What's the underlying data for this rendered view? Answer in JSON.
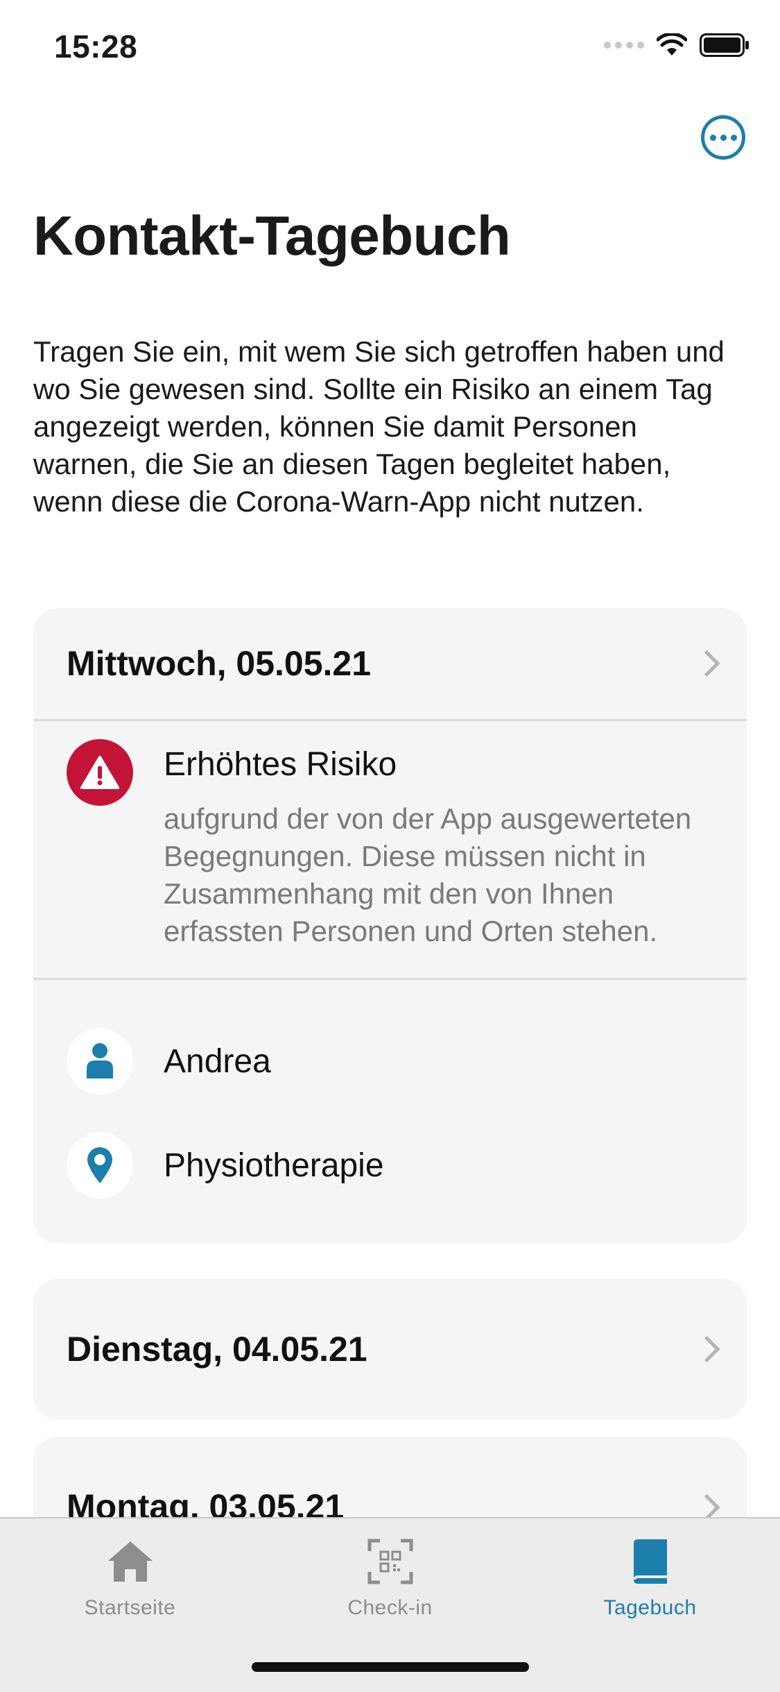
{
  "status_bar": {
    "time": "15:28"
  },
  "header": {
    "title": "Kontakt-Tagebuch",
    "intro": "Tragen Sie ein, mit wem Sie sich getroffen haben und wo Sie gewesen sind. Sollte ein Risiko an einem Tag angezeigt werden, können Sie damit Personen warnen, die Sie an diesen Tagen begleitet haben, wenn diese die Corona-Warn-App nicht nutzen."
  },
  "days": [
    {
      "title": "Mittwoch, 05.05.21",
      "risk": {
        "title": "Erhöhtes Risiko",
        "description": "aufgrund der von der App ausgewerteten Begegnungen. Diese müssen nicht in Zusammenhang mit den von Ihnen erfassten Personen und Orten stehen."
      },
      "entries": [
        {
          "icon": "person-icon",
          "label": "Andrea"
        },
        {
          "icon": "location-pin-icon",
          "label": "Physiotherapie"
        }
      ]
    },
    {
      "title": "Dienstag, 04.05.21"
    },
    {
      "title": "Montag, 03.05.21"
    }
  ],
  "tabs": [
    {
      "icon": "home-icon",
      "label": "Startseite",
      "active": false
    },
    {
      "icon": "qr-code-icon",
      "label": "Check-in",
      "active": false
    },
    {
      "icon": "book-icon",
      "label": "Tagebuch",
      "active": true
    }
  ],
  "colors": {
    "accent": "#1c7eab",
    "risk_red": "#c31438",
    "card_background": "#f5f5f5",
    "inactive_tab": "#8d8d8d"
  }
}
